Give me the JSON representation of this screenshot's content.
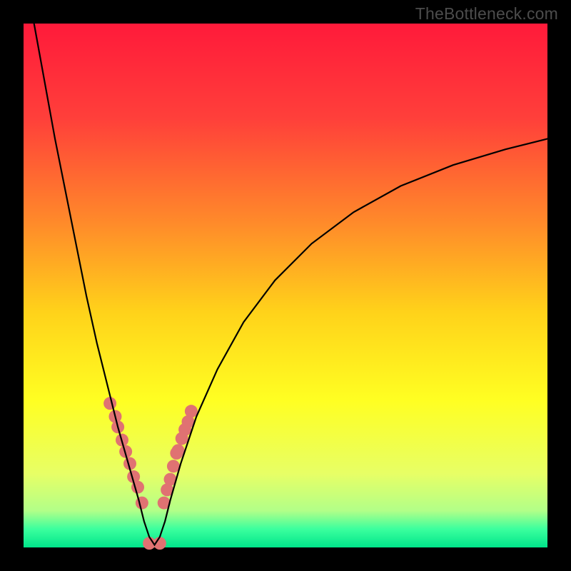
{
  "watermark": "TheBottleneck.com",
  "gradient": {
    "stops": [
      {
        "offset": 0.0,
        "color": "#ff1a3a"
      },
      {
        "offset": 0.18,
        "color": "#ff3f3a"
      },
      {
        "offset": 0.38,
        "color": "#ff8a2a"
      },
      {
        "offset": 0.55,
        "color": "#ffd21a"
      },
      {
        "offset": 0.72,
        "color": "#ffff22"
      },
      {
        "offset": 0.86,
        "color": "#e7ff66"
      },
      {
        "offset": 0.93,
        "color": "#b2ff88"
      },
      {
        "offset": 0.965,
        "color": "#3bff9e"
      },
      {
        "offset": 1.0,
        "color": "#00e58a"
      }
    ]
  },
  "dot_color": "#e07272",
  "dot_radius": 9,
  "curve_color": "#000000",
  "curve_width": 2.2,
  "chart_data": {
    "type": "line",
    "title": "",
    "xlabel": "",
    "ylabel": "",
    "xlim": [
      0,
      100
    ],
    "ylim": [
      0,
      100
    ],
    "notch_x": 25,
    "series": [
      {
        "name": "bottleneck-curve",
        "x": [
          2,
          4,
          6,
          8,
          10,
          12,
          14,
          16,
          18,
          20,
          22,
          23,
          24,
          25,
          26,
          27,
          28,
          30,
          33,
          37,
          42,
          48,
          55,
          63,
          72,
          82,
          92,
          100
        ],
        "y": [
          100,
          89,
          78,
          68,
          58,
          48,
          39,
          31,
          23,
          16,
          9,
          5,
          2,
          0.5,
          2,
          5,
          9,
          16,
          25,
          34,
          43,
          51,
          58,
          64,
          69,
          73,
          76,
          78
        ]
      }
    ],
    "highlight_dots": {
      "name": "marked-points",
      "x": [
        16.5,
        17.5,
        18,
        18.8,
        19.5,
        20.3,
        21,
        21.8,
        22.6,
        24,
        26,
        26.8,
        27.4,
        28,
        28.6,
        29.2,
        29.5,
        30.2,
        30.8,
        31.4,
        32
      ],
      "y": [
        27.5,
        25,
        23,
        20.5,
        18.3,
        16,
        13.5,
        11.5,
        8.5,
        0.8,
        0.8,
        8.5,
        11,
        13,
        15.5,
        18,
        18.5,
        20.8,
        22.5,
        24,
        26
      ]
    }
  }
}
